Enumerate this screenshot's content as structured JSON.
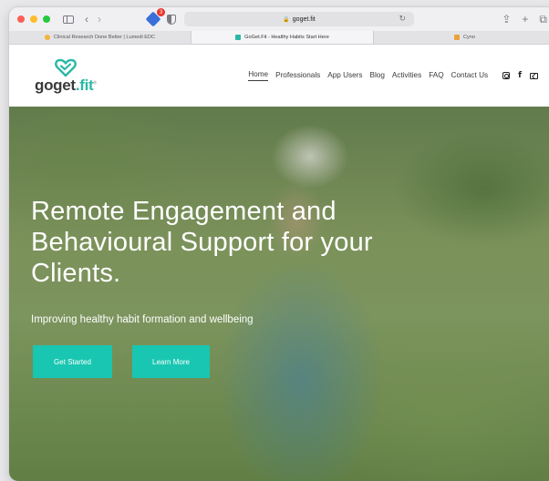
{
  "browser": {
    "address": "goget.fit",
    "extension_badge": "3",
    "tabs": [
      {
        "label": "Clinical Research Done Better | Lumedi EDC",
        "favicon_color": "#f3b33d"
      },
      {
        "label": "GoGet.Fit - Healthy Habits Start Here",
        "favicon_color": "#2bb8a6"
      },
      {
        "label": "Cyno",
        "favicon_color": "#e9a23b"
      }
    ]
  },
  "site": {
    "logo": {
      "go": "go",
      "get": "get",
      "fit": ".fit",
      "mark": "®"
    },
    "nav": [
      "Home",
      "Professionals",
      "App Users",
      "Blog",
      "Activities",
      "FAQ",
      "Contact Us"
    ],
    "active_nav": "Home"
  },
  "hero": {
    "headline": "Remote Engagement and Behavioural Support for your Clients.",
    "subheadline": "Improving healthy habit formation and wellbeing",
    "cta_primary": "Get Started",
    "cta_secondary": "Learn More"
  },
  "colors": {
    "accent": "#19c6b1",
    "brand_teal": "#2bb8a6",
    "text_dark": "#3a3a3a"
  }
}
